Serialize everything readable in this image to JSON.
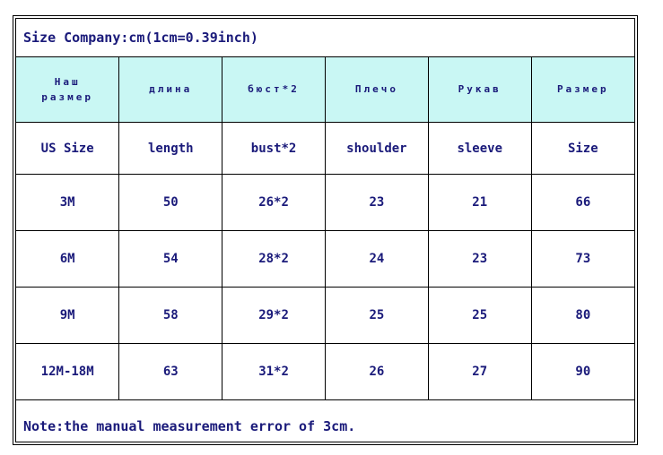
{
  "title": "Size Company:cm(1cm=0.39inch)",
  "note": "Note:the manual measurement error of 3cm.",
  "colors": {
    "header_fill": "#c9f7f4",
    "text": "#1a1a7a",
    "border": "#000000",
    "background": "#ffffff"
  },
  "table": {
    "headers_ru": [
      {
        "line1": "Наш",
        "line2": "размер"
      },
      {
        "line1": "",
        "line2": "длина"
      },
      {
        "line1": "",
        "line2": "бюст*2"
      },
      {
        "line1": "",
        "line2": "Плечо"
      },
      {
        "line1": "",
        "line2": "Рукав"
      },
      {
        "line1": "",
        "line2": "Размер"
      }
    ],
    "headers_en": [
      "US Size",
      "length",
      "bust*2",
      "shoulder",
      "sleeve",
      "Size"
    ],
    "rows": [
      [
        "3M",
        "50",
        "26*2",
        "23",
        "21",
        "66"
      ],
      [
        "6M",
        "54",
        "28*2",
        "24",
        "23",
        "73"
      ],
      [
        "9M",
        "58",
        "29*2",
        "25",
        "25",
        "80"
      ],
      [
        "12M-18M",
        "63",
        "31*2",
        "26",
        "27",
        "90"
      ]
    ]
  },
  "chart_data": {
    "type": "table",
    "title": "Size Company:cm(1cm=0.39inch)",
    "columns": [
      "US Size",
      "length",
      "bust*2",
      "shoulder",
      "sleeve",
      "Size"
    ],
    "columns_ru": [
      "Наш размер",
      "длина",
      "бюст*2",
      "Плечо",
      "Рукав",
      "Размер"
    ],
    "rows": [
      [
        "3M",
        "50",
        "26*2",
        "23",
        "21",
        "66"
      ],
      [
        "6M",
        "54",
        "28*2",
        "24",
        "23",
        "73"
      ],
      [
        "9M",
        "58",
        "29*2",
        "25",
        "25",
        "80"
      ],
      [
        "12M-18M",
        "63",
        "31*2",
        "26",
        "27",
        "90"
      ]
    ],
    "annotation": "Note:the manual measurement error of 3cm."
  }
}
